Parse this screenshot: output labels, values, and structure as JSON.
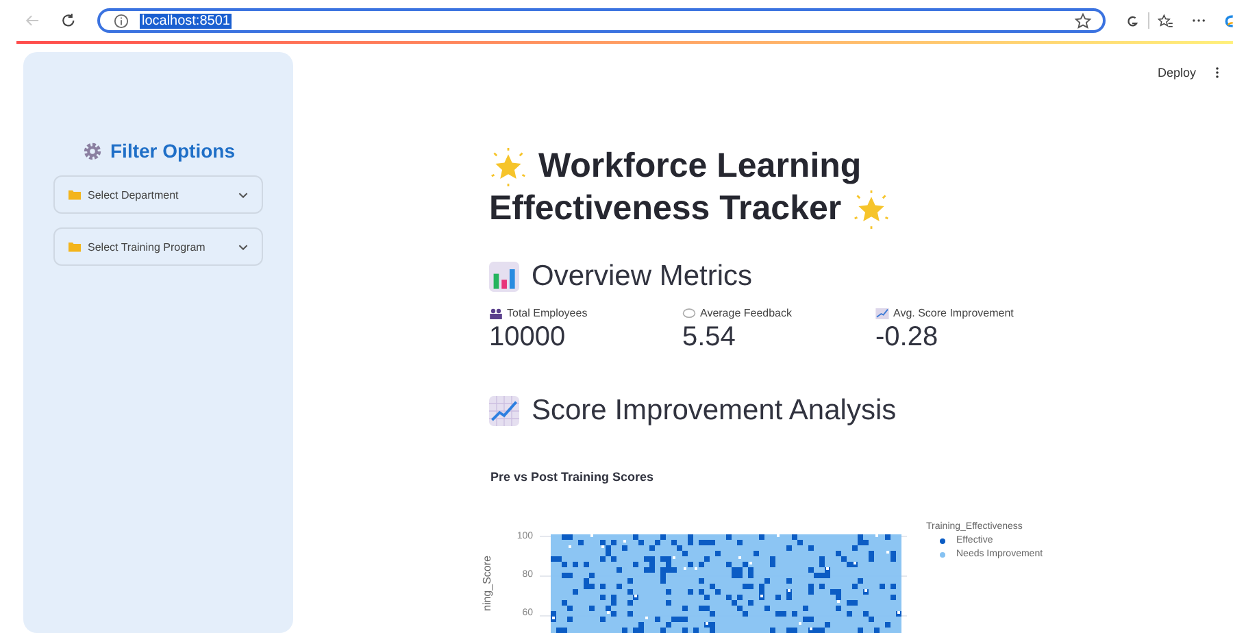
{
  "browser": {
    "url": "localhost:8501",
    "url_selected": true
  },
  "header": {
    "deploy": "Deploy"
  },
  "sidebar": {
    "title": "Filter Options",
    "filters": [
      {
        "label": "Select Department"
      },
      {
        "label": "Select Training Program"
      }
    ]
  },
  "main": {
    "title_line_1": "Workforce Learning",
    "title_line_2": "Effectiveness Tracker",
    "overview_heading": "Overview Metrics",
    "metrics": [
      {
        "kind": "people",
        "label": "Total Employees",
        "value": "10000"
      },
      {
        "kind": "speech",
        "label": "Average Feedback",
        "value": "5.54"
      },
      {
        "kind": "trend",
        "label": "Avg. Score Improvement",
        "value": "-0.28"
      }
    ],
    "analysis_heading": "Score Improvement Analysis",
    "scatter": {
      "title": "Pre vs Post Training Scores",
      "ylabel": "ning_Score",
      "yticks": [
        "100",
        "80",
        "60"
      ],
      "legend_title": "Training_Effectiveness",
      "legend": [
        {
          "label": "Effective",
          "color": "#0b5cc4"
        },
        {
          "label": "Needs Improvement",
          "color": "#86c2f2"
        }
      ]
    }
  }
}
